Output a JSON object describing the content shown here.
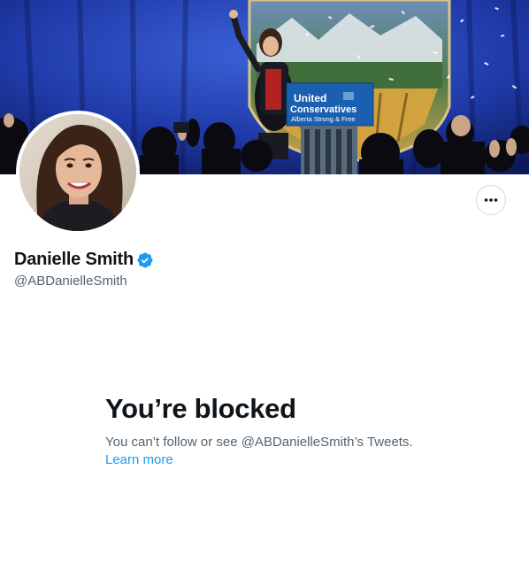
{
  "profile": {
    "display_name": "Danielle Smith",
    "handle": "@ABDanielleSmith",
    "verified": true,
    "accent_color": "#1d9bf0"
  },
  "banner": {
    "sign_line1": "United",
    "sign_line2": "Conservatives",
    "sign_line3": "Alberta Strong & Free"
  },
  "actions": {
    "more_icon": "more-horizontal-icon"
  },
  "blocked": {
    "title": "You’re blocked",
    "description": "You can’t follow or see @ABDanielleSmith’s Tweets.",
    "learn_more": "Learn more"
  }
}
